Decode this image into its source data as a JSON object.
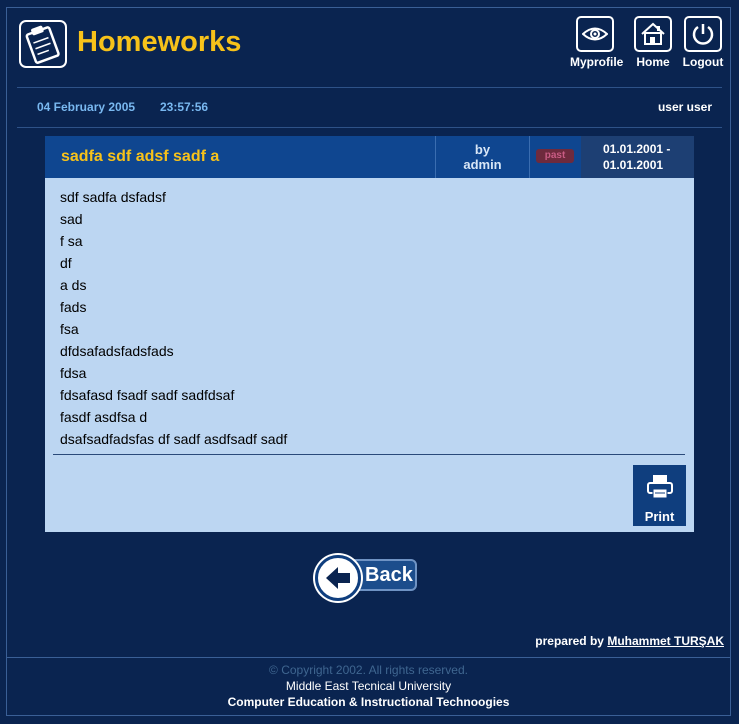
{
  "app": {
    "title": "Homeworks",
    "icon": "clipboard-icon"
  },
  "nav": [
    {
      "label": "Myprofile",
      "icon": "eye-icon"
    },
    {
      "label": "Home",
      "icon": "house-icon"
    },
    {
      "label": "Logout",
      "icon": "power-icon"
    }
  ],
  "status": {
    "date": "04 February 2005",
    "time": "23:57:56",
    "user": "user user"
  },
  "homework": {
    "title": "sadfa sdf adsf sadf a",
    "by_label": "by",
    "author": "admin",
    "badge": "past",
    "date_from": "01.01.2001 -",
    "date_to": "01.01.2001",
    "lines": [
      "sdf sadfa dsfadsf",
      "sad",
      "f sa",
      "df",
      "a ds",
      "fads",
      "fsa",
      "dfdsafadsfadsfads",
      "fdsa",
      "fdsafasd fsadf sadf sadfdsaf",
      "fasdf asdfsa d",
      "dsafsadfadsfas df sadf asdfsadf sadf"
    ],
    "print_label": "Print"
  },
  "back_label": "Back",
  "credits": {
    "prepared_by": "prepared by",
    "author": "Muhammet TURŞAK"
  },
  "footer": {
    "copyright": "© Copyright 2002. All rights reserved.",
    "university": "Middle East Tecnical University",
    "department": "Computer Education & Instructional Technoogies"
  },
  "colors": {
    "background": "#0a2450",
    "title_accent": "#f7c21a",
    "card_header": "#0f4690",
    "card_body": "#bcd6f2",
    "date_text": "#79b8f0"
  }
}
